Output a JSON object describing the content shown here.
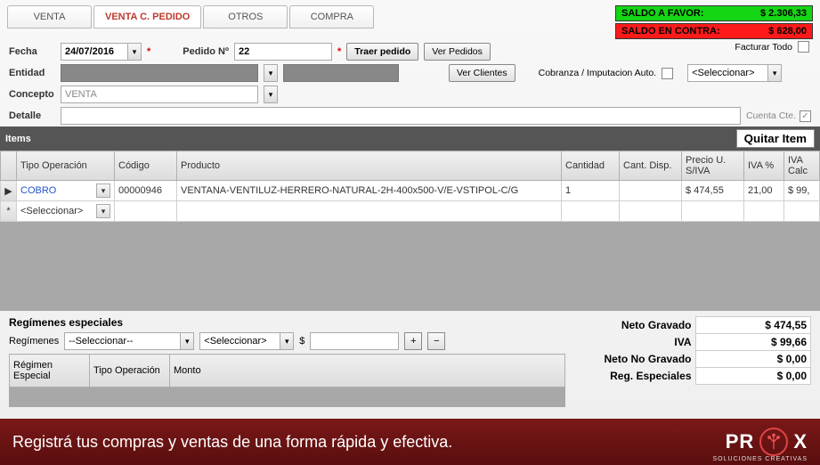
{
  "tabs": {
    "venta": "VENTA",
    "venta_pedido": "VENTA C. PEDIDO",
    "otros": "OTROS",
    "compra": "COMPRA"
  },
  "balances": {
    "favor": {
      "label": "SALDO A FAVOR:",
      "value": "$ 2.306,33"
    },
    "contra": {
      "label": "SALDO EN CONTRA:",
      "value": "$ 628,00"
    }
  },
  "form": {
    "fecha_label": "Fecha",
    "fecha": "24/07/2016",
    "pedido_label": "Pedido Nº",
    "pedido": "22",
    "traer": "Traer pedido",
    "ver_pedidos": "Ver Pedidos",
    "ver_clientes": "Ver Clientes",
    "entidad_label": "Entidad",
    "concepto_label": "Concepto",
    "concepto": "VENTA",
    "detalle_label": "Detalle",
    "detalle": "",
    "facturar_todo": "Facturar Todo",
    "cobranza": "Cobranza / Imputacion Auto.",
    "seleccionar": "<Seleccionar>",
    "cuenta_cte": "Cuenta Cte."
  },
  "items": {
    "title": "Items",
    "quitar": "Quitar Item",
    "cols": {
      "tipo": "Tipo Operación",
      "codigo": "Código",
      "producto": "Producto",
      "cantidad": "Cantidad",
      "disp": "Cant. Disp.",
      "precio": "Precio U. S/IVA",
      "iva": "IVA %",
      "ivacalc": "IVA Calc"
    },
    "rows": [
      {
        "tipo": "COBRO",
        "codigo": "00000946",
        "producto": "VENTANA-VENTILUZ-HERRERO-NATURAL-2H-400x500-V/E-VSTIPOL-C/G",
        "cantidad": "1",
        "disp": "",
        "precio": "$ 474,55",
        "iva": "21,00",
        "ivacalc": "$ 99,"
      }
    ],
    "new_placeholder": "<Seleccionar>"
  },
  "regimes": {
    "title": "Regímenes especiales",
    "label": "Regímenes",
    "sel": "--Seleccionar--",
    "sel2": "<Seleccionar>",
    "dollar": "$",
    "cols": {
      "reg": "Régimen Especial",
      "tipo": "Tipo Operación",
      "monto": "Monto"
    }
  },
  "totals": {
    "neto_gravado": {
      "label": "Neto Gravado",
      "value": "$ 474,55"
    },
    "iva": {
      "label": "IVA",
      "value": "$ 99,66"
    },
    "neto_no_gravado": {
      "label": "Neto No Gravado",
      "value": "$ 0,00"
    },
    "reg_esp": {
      "label": "Reg. Especiales",
      "value": "$ 0,00"
    }
  },
  "footer": {
    "text": "Registrá tus compras y ventas de una forma rápida y efectiva.",
    "brand_pre": "PR",
    "brand_post": "X",
    "sub": "SOLUCIONES CREATIVAS"
  }
}
